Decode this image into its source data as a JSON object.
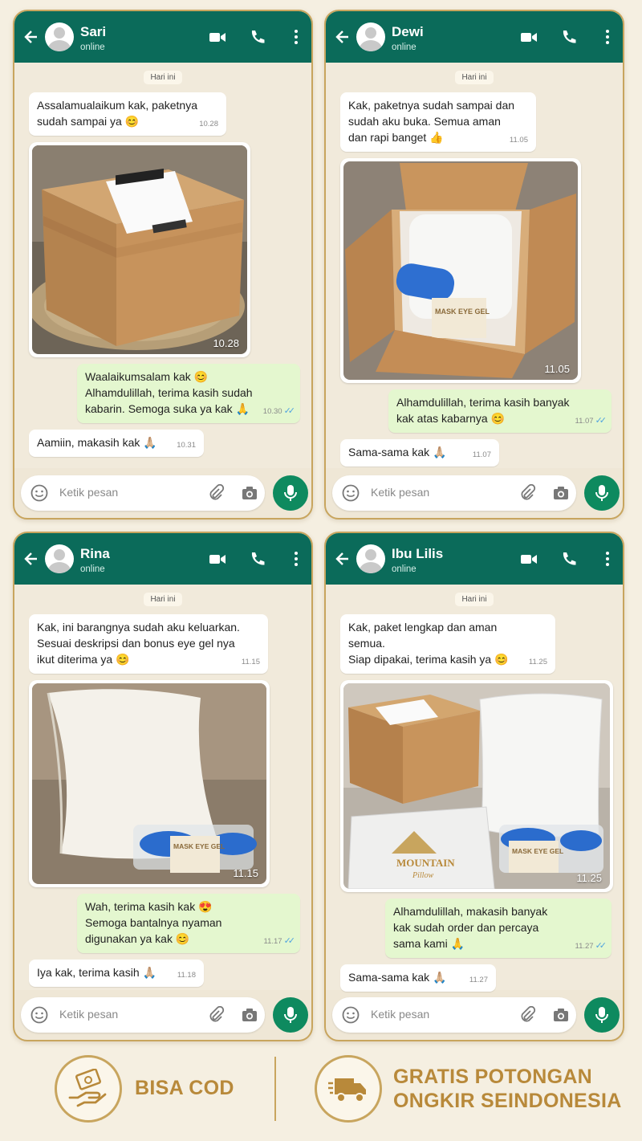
{
  "chats": [
    {
      "name": "Sari",
      "status": "online",
      "day": "Hari ini",
      "placeholder": "Ketik pesan",
      "m1": "Assalamualaikum kak, paketnya\nsudah sampai ya 😊",
      "m1t": "10.28",
      "img_t": "10.28",
      "m2": "Waalaikumsalam kak 😊\nAlhamdulillah, terima kasih sudah\nkabarin. Semoga suka ya kak 🙏",
      "m2t": "10.30",
      "m3": "Aamiin, makasih kak 🙏🏼",
      "m3t": "10.31"
    },
    {
      "name": "Dewi",
      "status": "online",
      "day": "Hari ini",
      "placeholder": "Ketik pesan",
      "m1": "Kak, paketnya sudah sampai dan\nsudah aku buka. Semua aman\ndan rapi banget 👍",
      "m1t": "11.05",
      "img_t": "11.05",
      "img_label": "MASK EYE GEL",
      "m2": "Alhamdulillah, terima kasih banyak\nkak atas kabarnya 😊",
      "m2t": "11.07",
      "m3": "Sama-sama kak 🙏🏼",
      "m3t": "11.07"
    },
    {
      "name": "Rina",
      "status": "online",
      "day": "Hari ini",
      "placeholder": "Ketik pesan",
      "m1": "Kak, ini barangnya sudah aku keluarkan.\nSesuai deskripsi dan bonus eye gel nya\nikut diterima ya 😊",
      "m1t": "11.15",
      "img_t": "11.15",
      "img_label": "MASK EYE GEL",
      "m2": "Wah, terima kasih kak 😍\nSemoga bantalnya nyaman\ndigunakan ya kak 😊",
      "m2t": "11.17",
      "m3": "Iya kak, terima kasih 🙏🏼",
      "m3t": "11.18"
    },
    {
      "name": "Ibu Lilis",
      "status": "online",
      "day": "Hari ini",
      "placeholder": "Ketik pesan",
      "m1": "Kak, paket lengkap dan aman semua.\nSiap dipakai, terima kasih ya 😊",
      "m1t": "11.25",
      "img_t": "11.25",
      "img_label": "MASK EYE GEL",
      "brand": "MOUNTAIN",
      "brand_sub": "Pillow",
      "m2": "Alhamdulillah, makasih banyak\nkak sudah order dan percaya\nsama kami 🙏",
      "m2t": "11.27",
      "m3": "Sama-sama kak 🙏🏼",
      "m3t": "11.27"
    }
  ],
  "footer": {
    "cod": "BISA COD",
    "ongkir_1": "GRATIS POTONGAN",
    "ongkir_2": "ONGKIR SEINDONESIA",
    "cod_icon": "hand-money-icon",
    "ongkir_icon": "delivery-truck-icon"
  },
  "colors": {
    "header": "#0b6b5a",
    "accent": "#c8a55e",
    "out_bubble": "#e4f7cf",
    "mic": "#0e8a5f"
  }
}
